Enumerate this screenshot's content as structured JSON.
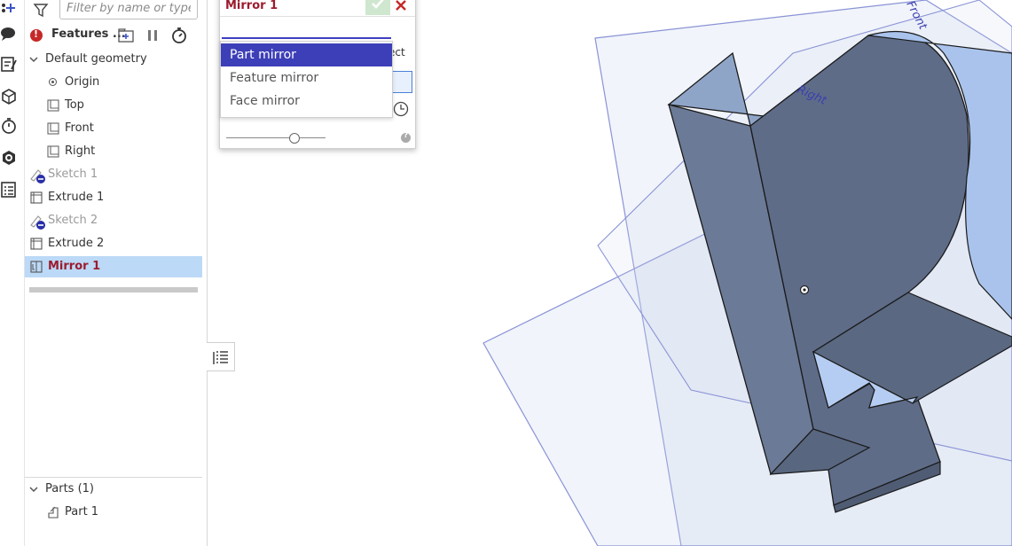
{
  "filter": {
    "placeholder": "Filter by name or type"
  },
  "features_header": {
    "title": "Features ..."
  },
  "tree": {
    "default_geometry": "Default geometry",
    "origin": "Origin",
    "top": "Top",
    "front": "Front",
    "right": "Right",
    "sketch1": "Sketch 1",
    "extrude1": "Extrude 1",
    "sketch2": "Sketch 2",
    "extrude2": "Extrude 2",
    "mirror1": "Mirror 1"
  },
  "parts": {
    "header": "Parts (1)",
    "item1": "Part 1"
  },
  "dialog": {
    "title": "Mirror 1",
    "input_value": "",
    "hint_text": "ect",
    "slider_fraction": 0.69
  },
  "dropdown": {
    "options": [
      "Part mirror",
      "Feature mirror",
      "Face mirror"
    ],
    "selected": "Part mirror"
  },
  "viewport": {
    "plane_front": "Front",
    "plane_right": "Right"
  },
  "colors": {
    "accent": "#3d3fb8",
    "feature_red": "#9b1c2e",
    "selection_blue": "#bcd9f7",
    "part_face": "#5d6b85"
  }
}
